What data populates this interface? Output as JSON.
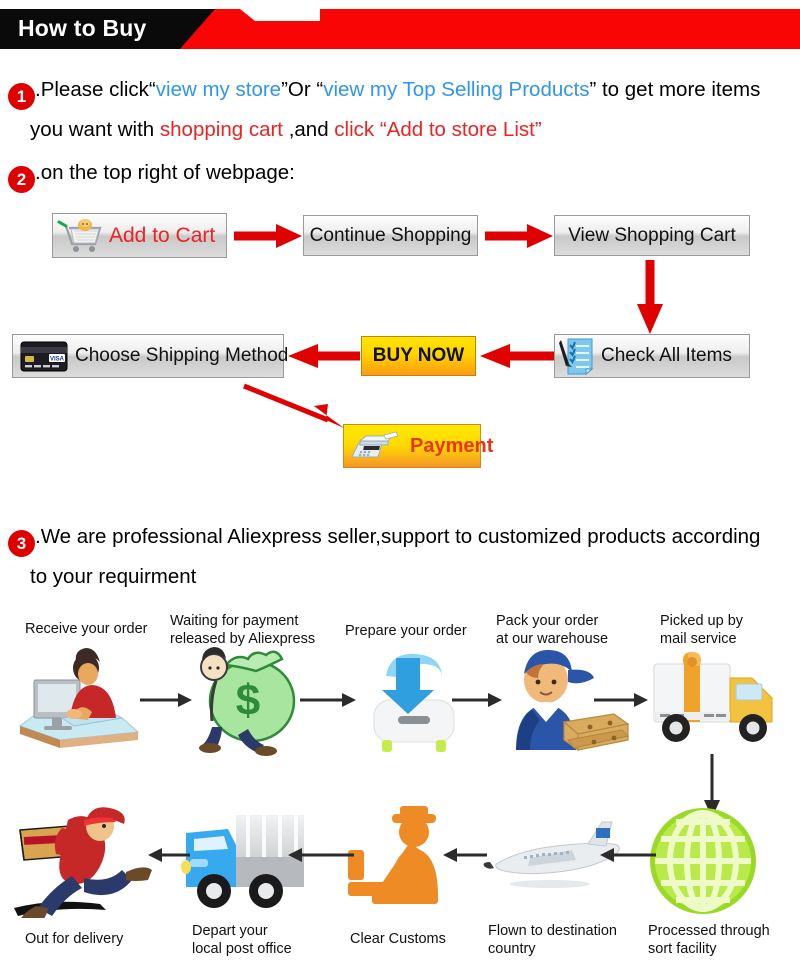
{
  "banner": {
    "title": "How to Buy",
    "black_color": "#0a0a0a",
    "red_color": "#f90505"
  },
  "steps": {
    "one": {
      "number": "1",
      "t1": ".Please click“",
      "link1": "view my store",
      "t2": "”Or “",
      "link2": "view my Top Selling Products",
      "t3": "” to get more items",
      "line2_t1": "you want with ",
      "line2_red1": "shopping cart",
      "line2_t2": " ,and ",
      "line2_red2": "click “Add to store List”"
    },
    "two": {
      "number": "2",
      "text": ".on the top right of webpage:"
    },
    "three": {
      "number": "3",
      "line1": ".We are professional Aliexpress seller,support to customized products according",
      "line2": "to your requirment"
    }
  },
  "buy_flow": {
    "buttons": [
      {
        "id": "add-to-cart",
        "label": "Add to Cart",
        "icon": "shopping-cart-icon",
        "style": "grey-red-text"
      },
      {
        "id": "continue-shopping",
        "label": "Continue Shopping",
        "icon": "",
        "style": "grey"
      },
      {
        "id": "view-shopping-cart",
        "label": "View Shopping Cart",
        "icon": "",
        "style": "grey"
      },
      {
        "id": "check-all-items",
        "label": "Check All Items",
        "icon": "checklist-icon",
        "style": "grey"
      },
      {
        "id": "buy-now",
        "label": "BUY NOW",
        "icon": "",
        "style": "yellow"
      },
      {
        "id": "choose-shipping",
        "label": "Choose Shipping Method",
        "icon": "credit-card-icon",
        "style": "grey"
      },
      {
        "id": "payment",
        "label": "Payment",
        "icon": "cash-register-icon",
        "style": "yellow-orange"
      }
    ],
    "arrow_color": "#e00000"
  },
  "shipping_flow": {
    "arrow_color": "#2b2b2b",
    "row1": [
      {
        "label_line1": "Receive your order",
        "label_line2": "",
        "icon": "person-at-computer-icon"
      },
      {
        "label_line1": "Waiting for payment",
        "label_line2": "released by Aliexpress",
        "icon": "money-bag-icon"
      },
      {
        "label_line1": "Prepare your order",
        "label_line2": "",
        "icon": "download-box-icon"
      },
      {
        "label_line1": "Pack your order",
        "label_line2": "at our warehouse",
        "icon": "worker-packing-icon"
      },
      {
        "label_line1": "Picked up by",
        "label_line2": "mail service",
        "icon": "delivery-truck-icon"
      }
    ],
    "row2": [
      {
        "label_line1": "Out for delivery",
        "label_line2": "",
        "icon": "running-courier-icon"
      },
      {
        "label_line1": "Depart your",
        "label_line2": "local post office",
        "icon": "blue-truck-icon"
      },
      {
        "label_line1": "Clear Customs",
        "label_line2": "",
        "icon": "customs-officer-icon"
      },
      {
        "label_line1": "Flown to destination",
        "label_line2": "country",
        "icon": "airplane-icon"
      },
      {
        "label_line1": "Processed through",
        "label_line2": "sort facility",
        "icon": "globe-grid-icon"
      }
    ]
  }
}
